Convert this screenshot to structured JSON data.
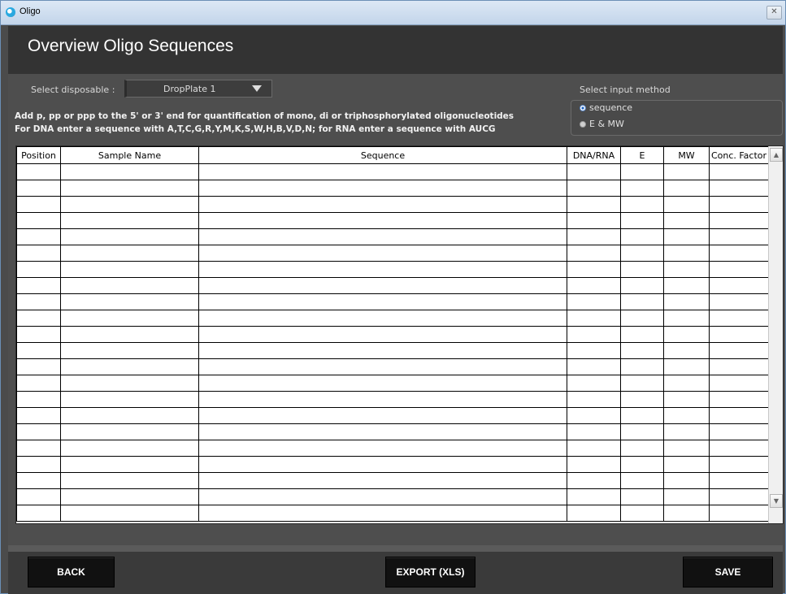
{
  "window": {
    "title": "Oligo",
    "close_glyph": "✕"
  },
  "header": {
    "title": "Overview Oligo Sequences"
  },
  "disposable": {
    "label": "Select disposable :",
    "value": "DropPlate 1"
  },
  "instructions": {
    "line1": "Add p, pp or ppp to the 5' or 3' end for quantification of mono, di or triphosphorylated oligonucleotides",
    "line2": "For DNA enter a sequence with A,T,C,G,R,Y,M,K,S,W,H,B,V,D,N; for RNA enter a sequence with AUCG"
  },
  "input_method": {
    "label": "Select input method",
    "options": [
      {
        "label": "sequence",
        "selected": true
      },
      {
        "label": "E & MW",
        "selected": false
      }
    ]
  },
  "table": {
    "columns": [
      "Position",
      "Sample Name",
      "Sequence",
      "DNA/RNA",
      "E",
      "MW",
      "Conc. Factor"
    ],
    "row_count": 22
  },
  "footer": {
    "back_label": "BACK",
    "export_label": "EXPORT (XLS)",
    "save_label": "SAVE"
  },
  "colors": {
    "header_bg": "#333333",
    "content_bg": "#4e4e4e",
    "button_bg": "#111111"
  },
  "icons": {
    "app": "oligo-app-icon",
    "close": "close-icon",
    "dropdown": "chevron-down-icon",
    "scroll_up": "scroll-up-arrow-icon",
    "scroll_down": "scroll-down-arrow-icon"
  }
}
